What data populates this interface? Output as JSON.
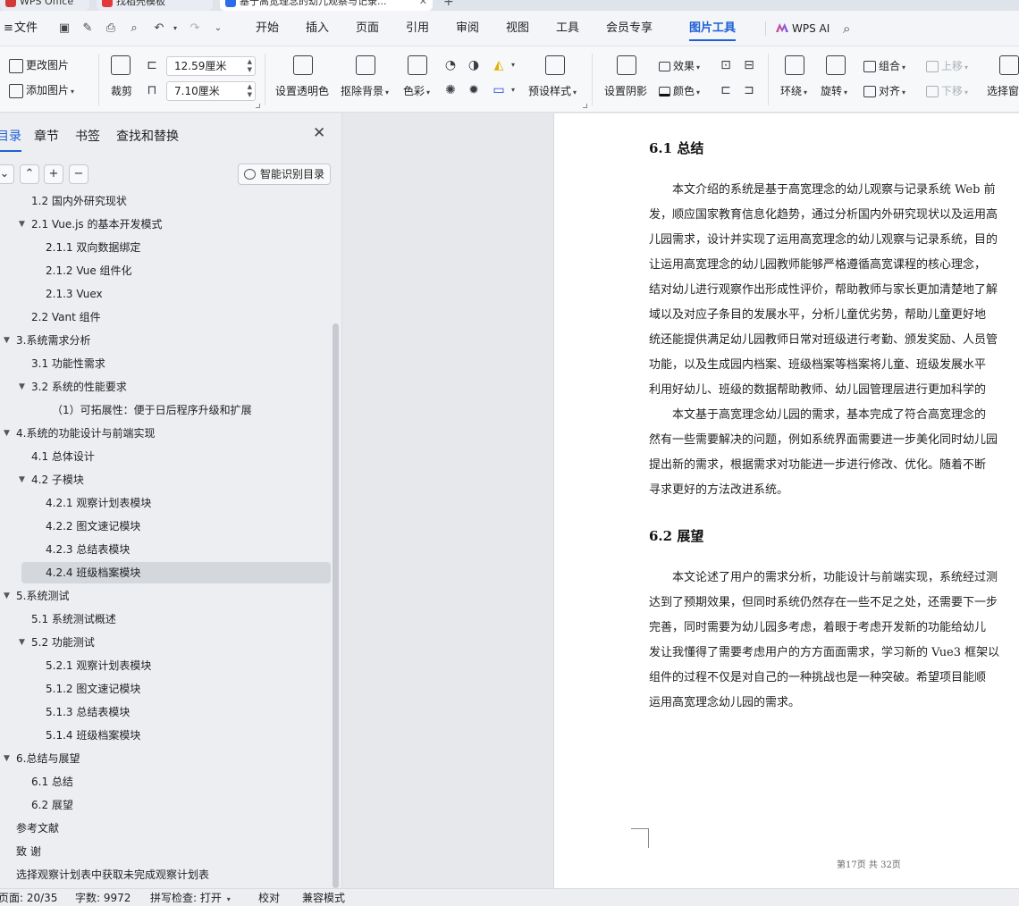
{
  "tabs": [
    {
      "label": "WPS Office",
      "icon": "wps-office-icon",
      "color": "#d23a3a"
    },
    {
      "label": "找稻壳模板",
      "icon": "docer-icon",
      "color": "#e23a3a"
    },
    {
      "label": "基于高宽理念的幼儿观察与记录...",
      "icon": "writer-doc-icon",
      "color": "#2b6de8"
    }
  ],
  "menu": {
    "file": "文件",
    "tabs": [
      "开始",
      "插入",
      "页面",
      "引用",
      "审阅",
      "视图",
      "工具",
      "会员专享",
      "图片工具"
    ],
    "active_tab": "图片工具",
    "wps_ai": "WPS AI"
  },
  "ribbon": {
    "change_image": "更改图片",
    "add_image": "添加图片",
    "crop": "裁剪",
    "width_value": "12.59厘米",
    "height_value": "7.10厘米",
    "set_transparent": "设置透明色",
    "remove_bg": "抠除背景",
    "color_mode": "色彩",
    "preset_style": "预设样式",
    "set_shadow": "设置阴影",
    "effects": "效果",
    "color": "颜色",
    "wrap": "环绕",
    "rotate": "旋转",
    "group": "组合",
    "align": "对齐",
    "bring_forward": "上移",
    "send_backward": "下移",
    "selection_pane": "选择窗"
  },
  "nav": {
    "tabs": [
      "目录",
      "章节",
      "书签",
      "查找和替换"
    ],
    "active_tab": "目录",
    "smart_toc": "智能识别目录",
    "items": [
      {
        "text": "1.2 国内外研究现状",
        "level": 2,
        "expand": ""
      },
      {
        "text": "2.1 Vue.js 的基本开发模式",
        "level": 2,
        "expand": "▼"
      },
      {
        "text": "2.1.1 双向数据绑定",
        "level": 3,
        "expand": ""
      },
      {
        "text": "2.1.2 Vue 组件化",
        "level": 3,
        "expand": ""
      },
      {
        "text": "2.1.3 Vuex",
        "level": 3,
        "expand": ""
      },
      {
        "text": "2.2 Vant 组件",
        "level": 2,
        "expand": ""
      },
      {
        "text": "3.系统需求分析",
        "level": 1,
        "expand": "▼"
      },
      {
        "text": "3.1  功能性需求",
        "level": 2,
        "expand": ""
      },
      {
        "text": "3.2  系统的性能要求",
        "level": 2,
        "expand": "▼"
      },
      {
        "text": "（1）可拓展性：便于日后程序升级和扩展",
        "level": 4,
        "expand": ""
      },
      {
        "text": "4.系统的功能设计与前端实现",
        "level": 1,
        "expand": "▼"
      },
      {
        "text": "4.1 总体设计",
        "level": 2,
        "expand": ""
      },
      {
        "text": "4.2 子模块",
        "level": 2,
        "expand": "▼"
      },
      {
        "text": "4.2.1 观察计划表模块",
        "level": 3,
        "expand": ""
      },
      {
        "text": "4.2.2 图文速记模块",
        "level": 3,
        "expand": ""
      },
      {
        "text": "4.2.3 总结表模块",
        "level": 3,
        "expand": ""
      },
      {
        "text": "4.2.4 班级档案模块",
        "level": 3,
        "expand": "",
        "selected": true
      },
      {
        "text": "5.系统测试",
        "level": 1,
        "expand": "▼"
      },
      {
        "text": "5.1 系统测试概述",
        "level": 2,
        "expand": ""
      },
      {
        "text": "5.2  功能测试",
        "level": 2,
        "expand": "▼"
      },
      {
        "text": "5.2.1 观察计划表模块",
        "level": 3,
        "expand": ""
      },
      {
        "text": "5.1.2 图文速记模块",
        "level": 3,
        "expand": ""
      },
      {
        "text": "5.1.3 总结表模块",
        "level": 3,
        "expand": ""
      },
      {
        "text": "5.1.4 班级档案模块",
        "level": 3,
        "expand": ""
      },
      {
        "text": "6.总结与展望",
        "level": 1,
        "expand": "▼"
      },
      {
        "text": "6.1 总结",
        "level": 2,
        "expand": ""
      },
      {
        "text": "6.2 展望",
        "level": 2,
        "expand": ""
      },
      {
        "text": "参考文献",
        "level": 1,
        "expand": ""
      },
      {
        "text": "致    谢",
        "level": 1,
        "expand": ""
      },
      {
        "text": "选择观察计划表中获取未完成观察计划表",
        "level": 1,
        "expand": ""
      }
    ]
  },
  "doc": {
    "h61": "6.1 总结",
    "p1": [
      "本文介绍的系统是基于高宽理念的幼儿观察与记录系统 Web 前",
      "发，顺应国家教育信息化趋势，通过分析国内外研究现状以及运用高",
      "儿园需求，设计并实现了运用高宽理念的幼儿观察与记录系统，目的",
      "让运用高宽理念的幼儿园教师能够严格遵循高宽课程的核心理念，",
      "结对幼儿进行观察作出形成性评价，帮助教师与家长更加清楚地了解",
      "域以及对应子条目的发展水平，分析儿童优劣势，帮助儿童更好地",
      "统还能提供满足幼儿园教师日常对班级进行考勤、颁发奖励、人员管",
      "功能，以及生成园内档案、班级档案等档案将儿童、班级发展水平",
      "利用好幼儿、班级的数据帮助教师、幼儿园管理层进行更加科学的"
    ],
    "p2": [
      "本文基于高宽理念幼儿园的需求，基本完成了符合高宽理念的",
      "然有一些需要解决的问题，例如系统界面需要进一步美化同时幼儿园",
      "提出新的需求，根据需求对功能进一步进行修改、优化。随着不断",
      "寻求更好的方法改进系统。"
    ],
    "h62": "6.2 展望",
    "p3": [
      "本文论述了用户的需求分析，功能设计与前端实现，系统经过测",
      "达到了预期效果，但同时系统仍然存在一些不足之处，还需要下一步",
      "完善，同时需要为幼儿园多考虑，着眼于考虑开发新的功能给幼儿",
      "发让我懂得了需要考虑用户的方方面面需求，学习新的 Vue3 框架以",
      "组件的过程不仅是对自己的一种挑战也是一种突破。希望项目能顺",
      "运用高宽理念幼儿园的需求。"
    ],
    "footer": "第17页  共 32页"
  },
  "status": {
    "page": "页面: 20/35",
    "words": "字数: 9972",
    "spell": "拼写检查: 打开",
    "proof": "校对",
    "compat": "兼容模式"
  },
  "colors": {
    "accent": "#1f5fd6"
  }
}
